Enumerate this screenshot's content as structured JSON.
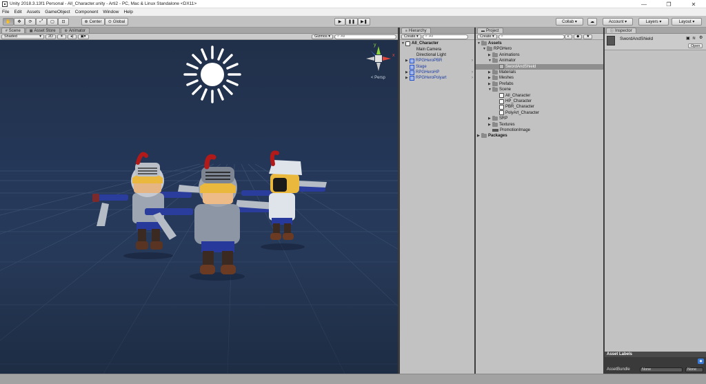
{
  "window": {
    "title": "Unity 2018.3.13f1 Personal - All_Character.unity - Arti2 - PC, Mac & Linux Standalone <DX11>",
    "controls": [
      "—",
      "❐",
      "✕"
    ]
  },
  "menu": [
    "File",
    "Edit",
    "Assets",
    "GameObject",
    "Component",
    "Window",
    "Help"
  ],
  "toolbar": {
    "tools": [
      "✋",
      "✥",
      "⟳",
      "⤢",
      "▢",
      "⊡"
    ],
    "pivot": "Center",
    "space": "Global",
    "play": "▶",
    "pause": "❚❚",
    "step": "▶❚",
    "collab": "Collab ▾",
    "cloud": "☁",
    "account": "Account ▾",
    "layers": "Layers ▾",
    "layout": "Layout ▾"
  },
  "scene_panel": {
    "tabs": [
      "Scene",
      "Asset Store",
      "Animator"
    ],
    "shading": "Shaded",
    "mode_2d": "2D",
    "gizmos": "Gizmos ▾",
    "search": "All",
    "persp": "< Persp",
    "axes": {
      "x": "x",
      "y": "y"
    }
  },
  "hierarchy": {
    "tab": "Hierarchy",
    "create": "Create ▾",
    "search": "All",
    "root": "All_Character",
    "items": [
      {
        "label": "Main Camera",
        "blue": false
      },
      {
        "label": "Directional Light",
        "blue": false
      },
      {
        "label": "RPGHeroPBR",
        "blue": true
      },
      {
        "label": "Stage",
        "blue": true
      },
      {
        "label": "RPGHeroHP",
        "blue": true
      },
      {
        "label": "RPGHeroPolyart",
        "blue": true
      }
    ]
  },
  "project": {
    "tab": "Project",
    "create": "Create ▾",
    "tree": [
      {
        "label": "Assets",
        "kind": "folder",
        "arrow": "▼",
        "bold": true
      },
      {
        "label": "RPGHero",
        "kind": "folder",
        "arrow": "▼"
      },
      {
        "label": "Animations",
        "kind": "folder",
        "arrow": "▶"
      },
      {
        "label": "Animator",
        "kind": "folder",
        "arrow": "▼"
      },
      {
        "label": "SwordAndShield",
        "kind": "anim",
        "arrow": "",
        "selected": true
      },
      {
        "label": "Materials",
        "kind": "folder",
        "arrow": "▶"
      },
      {
        "label": "Meshes",
        "kind": "folder",
        "arrow": "▶"
      },
      {
        "label": "Prefabs",
        "kind": "folder",
        "arrow": "▶"
      },
      {
        "label": "Scene",
        "kind": "folder",
        "arrow": "▼"
      },
      {
        "label": "All_Character",
        "kind": "scene",
        "arrow": ""
      },
      {
        "label": "HP_Character",
        "kind": "scene",
        "arrow": ""
      },
      {
        "label": "PBR_Character",
        "kind": "scene",
        "arrow": ""
      },
      {
        "label": "PolyArt_Character",
        "kind": "scene",
        "arrow": ""
      },
      {
        "label": "SRP",
        "kind": "folder",
        "arrow": "▶"
      },
      {
        "label": "Textures",
        "kind": "folder",
        "arrow": "▶"
      },
      {
        "label": "PromotionImage",
        "kind": "image",
        "arrow": ""
      },
      {
        "label": "Packages",
        "kind": "folder",
        "arrow": "▶",
        "bold": true
      }
    ]
  },
  "inspector": {
    "tab": "Inspector",
    "object": "SwordAndShield",
    "open": "Open",
    "asset_labels": "Asset Labels",
    "asset_bundle": "AssetBundle",
    "bundle_value": "None",
    "variant_value": "None"
  }
}
